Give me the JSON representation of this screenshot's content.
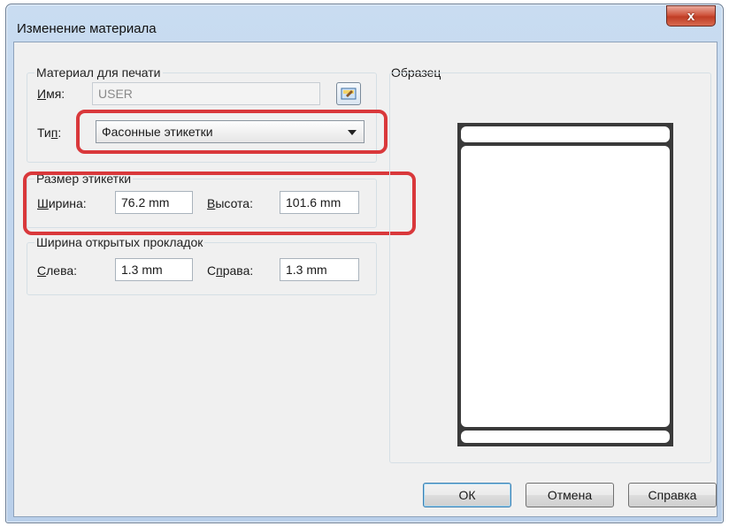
{
  "window": {
    "title": "Изменение материала",
    "close_glyph": "x"
  },
  "material": {
    "group_label": "Материал для печати",
    "name_label_u": "И",
    "name_label_rest": "мя:",
    "name_value": "USER",
    "type_label_pre": "Ти",
    "type_label_u": "п",
    "type_label_post": ":",
    "type_value": "Фасонные этикетки",
    "edit_icon": "label-edit-icon"
  },
  "label_size": {
    "group_label": "Размер этикетки",
    "width_label_u": "Ш",
    "width_label_rest": "ирина:",
    "width_value": "76.2 mm",
    "height_label_u": "В",
    "height_label_rest": "ысота:",
    "height_value": "101.6 mm"
  },
  "liner": {
    "group_label": "Ширина открытых прокладок",
    "left_label_u": "С",
    "left_label_rest": "лева:",
    "left_value": "1.3 mm",
    "right_label_pre": "С",
    "right_label_u": "п",
    "right_label_rest": "рава:",
    "right_value": "1.3 mm"
  },
  "sample": {
    "label": "Образец"
  },
  "buttons": {
    "ok": "ОК",
    "cancel": "Отмена",
    "help": "Справка"
  },
  "colors": {
    "highlight": "#d9383b",
    "close": "#c03d25"
  }
}
